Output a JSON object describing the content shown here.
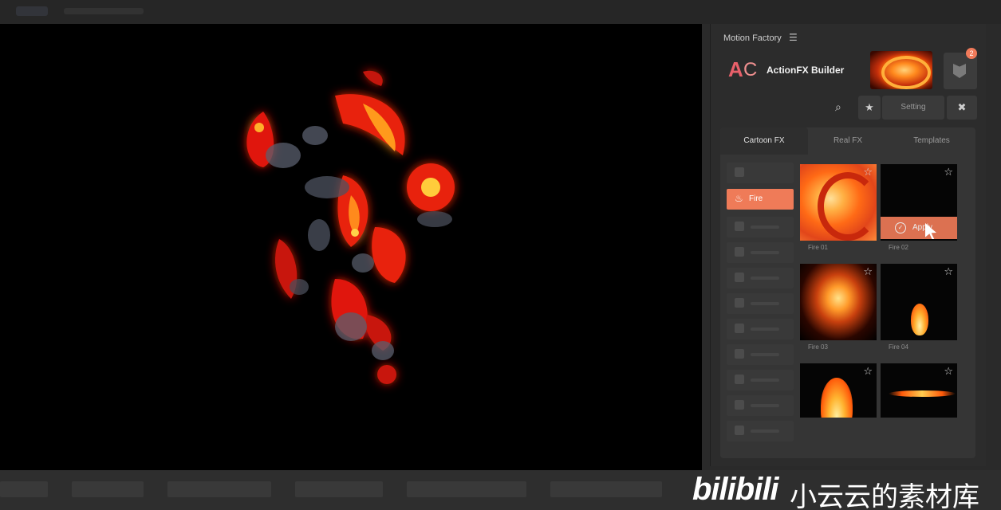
{
  "panel": {
    "title": "Motion Factory",
    "menu_icon": "hamburger-icon",
    "brand": {
      "logo_text_a": "A",
      "logo_text_c": "C",
      "name": "ActionFX Builder"
    },
    "notification_count": "2",
    "toolbar": {
      "search_icon": "⌕",
      "star_icon": "★",
      "setting_label": "Setting",
      "tools_icon": "✖"
    },
    "tabs": [
      {
        "label": "Cartoon FX",
        "active": true
      },
      {
        "label": "Real FX",
        "active": false
      },
      {
        "label": "Templates",
        "active": false
      }
    ],
    "categories": {
      "active_label": "Fire",
      "active_icon": "flame-icon"
    },
    "thumbnails": [
      {
        "caption": "Fire 01"
      },
      {
        "caption": "Fire 02",
        "apply_label": "Apply"
      },
      {
        "caption": "Fire 03"
      },
      {
        "caption": "Fire 04"
      },
      {
        "caption": ""
      },
      {
        "caption": ""
      }
    ]
  },
  "watermark": {
    "logo": "bilibili",
    "text": "小云云的素材库"
  },
  "colors": {
    "accent": "#ef7b58",
    "panel_bg": "#2c2c2c",
    "viewport_bg": "#000000"
  }
}
